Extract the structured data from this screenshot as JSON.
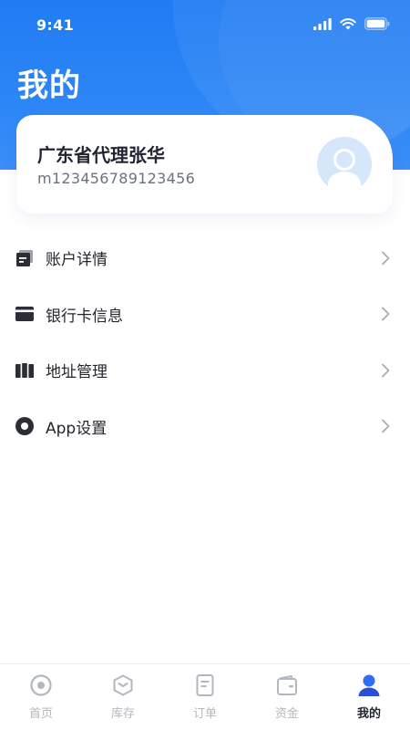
{
  "status_bar": {
    "time": "9:41"
  },
  "page": {
    "title": "我的"
  },
  "profile": {
    "name": "广东省代理张华",
    "account_id": "m123456789123456"
  },
  "menu": {
    "items": [
      {
        "label": "账户详情",
        "icon": "document-icon"
      },
      {
        "label": "银行卡信息",
        "icon": "card-icon"
      },
      {
        "label": "地址管理",
        "icon": "columns-icon"
      },
      {
        "label": "App设置",
        "icon": "settings-ring-icon"
      }
    ]
  },
  "tabbar": {
    "items": [
      {
        "label": "首页",
        "icon": "home-target-icon",
        "active": false
      },
      {
        "label": "库存",
        "icon": "inventory-box-icon",
        "active": false
      },
      {
        "label": "订单",
        "icon": "order-doc-icon",
        "active": false
      },
      {
        "label": "资金",
        "icon": "wallet-icon",
        "active": false
      },
      {
        "label": "我的",
        "icon": "user-icon",
        "active": true
      }
    ]
  },
  "colors": {
    "header_blue": "#1f7cf3",
    "active_blue": "#2d6ff2",
    "inactive_gray": "#b3b7bf",
    "text_dark": "#1f2430"
  }
}
